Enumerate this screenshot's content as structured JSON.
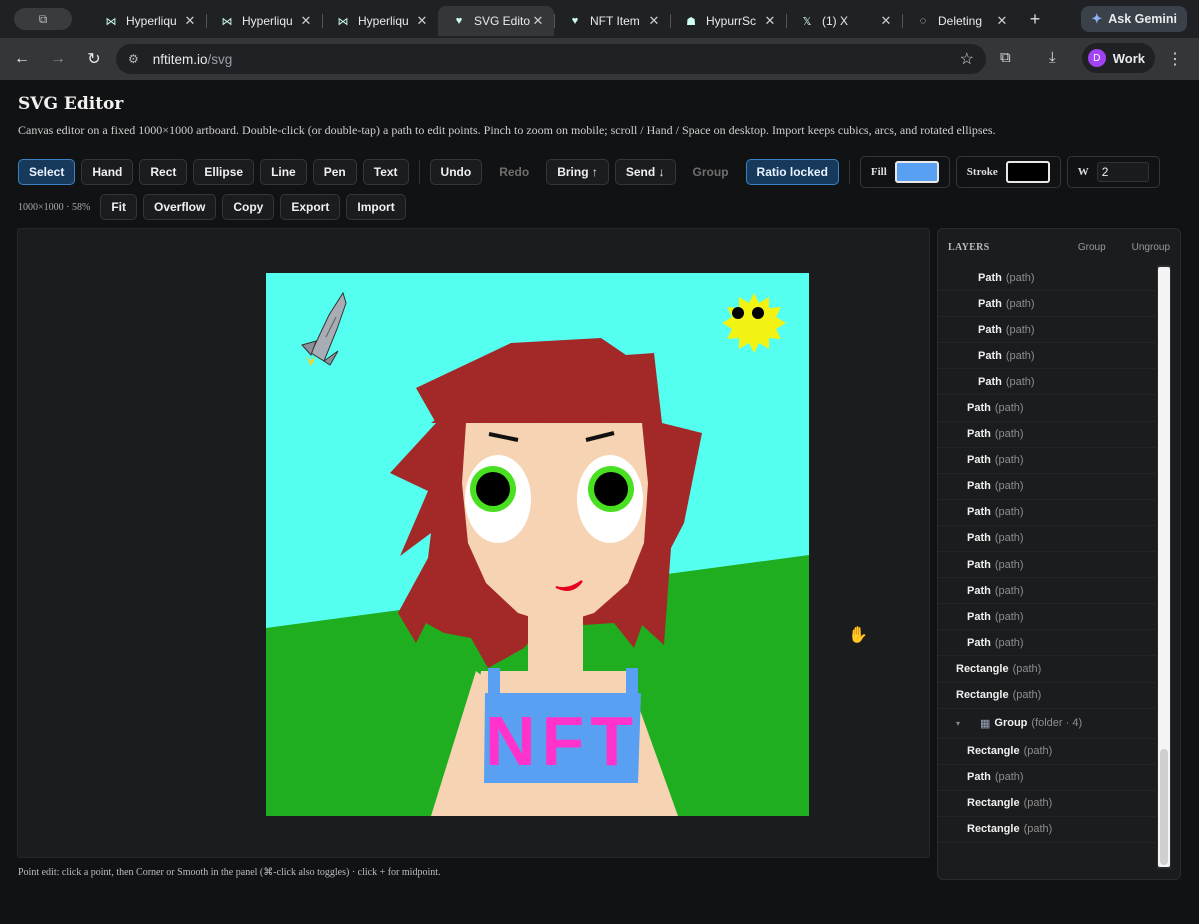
{
  "browser": {
    "tabs": [
      {
        "title": "Hyperliqu",
        "icon": "hyperliquid-icon",
        "active": false
      },
      {
        "title": "Hyperliqu",
        "icon": "hyperliquid-icon",
        "active": false
      },
      {
        "title": "Hyperliqu",
        "icon": "hyperliquid-icon",
        "active": false
      },
      {
        "title": "SVG Edito",
        "icon": "heart-icon",
        "active": true
      },
      {
        "title": "NFT Item",
        "icon": "heart-icon",
        "active": false
      },
      {
        "title": "HypurrSc",
        "icon": "cat-icon",
        "active": false
      },
      {
        "title": "(1) X",
        "icon": "x-logo-icon",
        "active": false
      },
      {
        "title": "Deleting",
        "icon": "loading-icon",
        "active": false
      }
    ],
    "gemini_label": "Ask Gemini",
    "url_host": "nftitem.io",
    "url_path": "/svg",
    "profile_label": "Work",
    "profile_initial": "D"
  },
  "page": {
    "title": "SVG Editor",
    "subtitle": "Canvas editor on a fixed 1000×1000 artboard. Double-click (or double-tap) a path to edit points. Pinch to zoom on mobile; scroll / Hand / Space on desktop. Import keeps cubics, arcs, and rotated ellipses.",
    "tools": {
      "select": "Select",
      "hand": "Hand",
      "rect": "Rect",
      "ellipse": "Ellipse",
      "line": "Line",
      "pen": "Pen",
      "text": "Text"
    },
    "actions": {
      "undo": "Undo",
      "redo": "Redo",
      "bring": "Bring ↑",
      "send": "Send ↓",
      "group": "Group",
      "ratio": "Ratio locked"
    },
    "fill_label": "Fill",
    "fill_color": "#5aa0f2",
    "stroke_label": "Stroke",
    "stroke_color": "#000000",
    "width_label": "W",
    "width_value": "2",
    "zoom_info": "1000×1000 · 58%",
    "view": {
      "fit": "Fit",
      "overflow": "Overflow",
      "copy": "Copy",
      "export": "Export",
      "import": "Import"
    },
    "footnote": "Point edit: click a point, then Corner or Smooth in the panel (⌘-click also toggles) · click + for midpoint."
  },
  "layers": {
    "header": "LAYERS",
    "group_btn": "Group",
    "ungroup_btn": "Ungroup",
    "items": [
      {
        "name": "Path",
        "type": "(path)",
        "depth": 2
      },
      {
        "name": "Path",
        "type": "(path)",
        "depth": 2
      },
      {
        "name": "Path",
        "type": "(path)",
        "depth": 2
      },
      {
        "name": "Path",
        "type": "(path)",
        "depth": 2
      },
      {
        "name": "Path",
        "type": "(path)",
        "depth": 2
      },
      {
        "name": "Path",
        "type": "(path)",
        "depth": 1
      },
      {
        "name": "Path",
        "type": "(path)",
        "depth": 1
      },
      {
        "name": "Path",
        "type": "(path)",
        "depth": 1
      },
      {
        "name": "Path",
        "type": "(path)",
        "depth": 1
      },
      {
        "name": "Path",
        "type": "(path)",
        "depth": 1
      },
      {
        "name": "Path",
        "type": "(path)",
        "depth": 1
      },
      {
        "name": "Path",
        "type": "(path)",
        "depth": 1
      },
      {
        "name": "Path",
        "type": "(path)",
        "depth": 1
      },
      {
        "name": "Path",
        "type": "(path)",
        "depth": 1
      },
      {
        "name": "Path",
        "type": "(path)",
        "depth": 1
      },
      {
        "name": "Rectangle",
        "type": "(path)",
        "depth": 0
      },
      {
        "name": "Rectangle",
        "type": "(path)",
        "depth": 0
      },
      {
        "name": "Group",
        "type": "(folder · 4)",
        "depth": 0,
        "group": true
      },
      {
        "name": "Rectangle",
        "type": "(path)",
        "depth": 1
      },
      {
        "name": "Path",
        "type": "(path)",
        "depth": 1
      },
      {
        "name": "Rectangle",
        "type": "(path)",
        "depth": 1
      },
      {
        "name": "Rectangle",
        "type": "(path)",
        "depth": 1
      }
    ]
  },
  "artwork": {
    "badge_text": "NFT",
    "colors": {
      "sky": "#55fff0",
      "grass": "#1fae1f",
      "hair": "#a32828",
      "skin": "#f6d3b2",
      "eye_ring": "#48e020",
      "shirt": "#5aa0f2",
      "badge_text": "#ff33cc",
      "sun": "#f2f213"
    }
  }
}
